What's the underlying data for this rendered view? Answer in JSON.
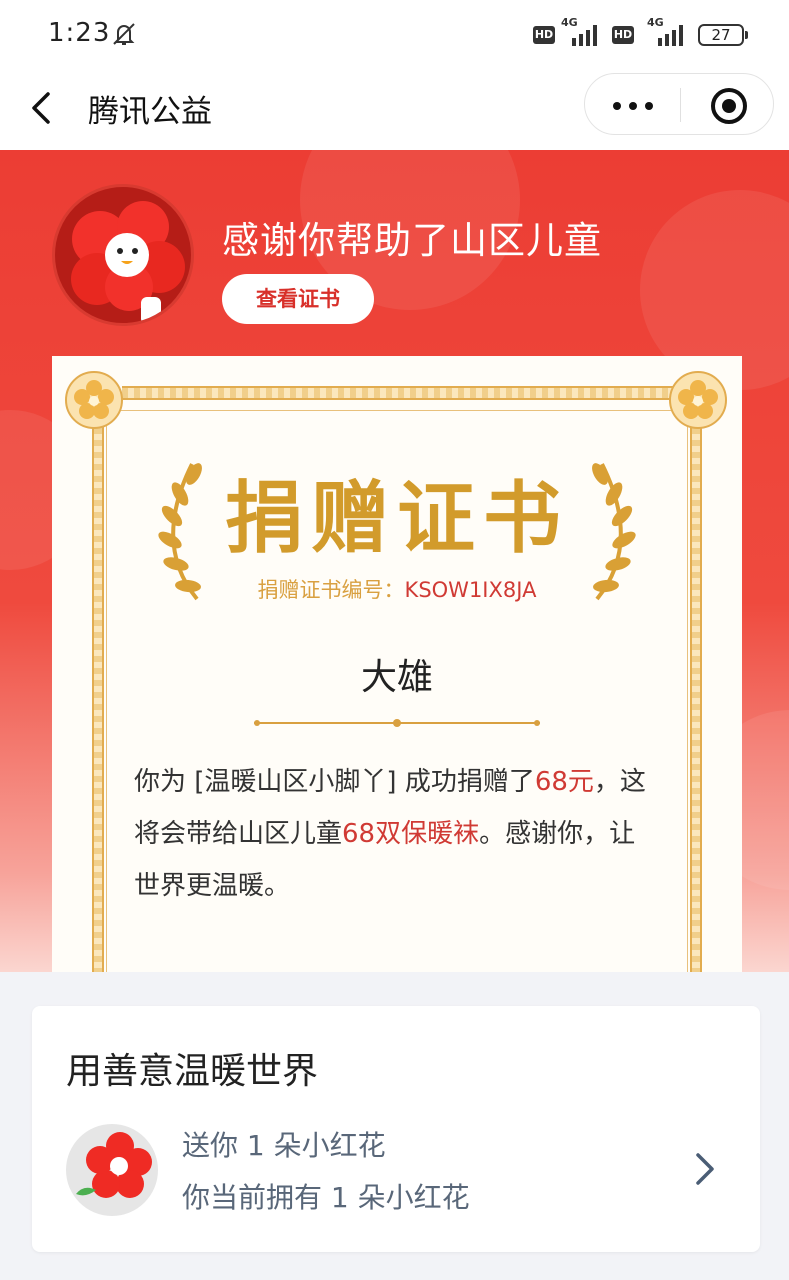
{
  "status_bar": {
    "time": "1:23",
    "network_1": "4G",
    "network_2": "4G",
    "hd_1": "HD",
    "hd_2": "HD",
    "battery": "27"
  },
  "nav": {
    "title": "腾讯公益"
  },
  "hero": {
    "title": "感谢你帮助了山区儿童",
    "view_certificate": "查看证书"
  },
  "certificate": {
    "heading": "捐赠证书",
    "number_label": "捐赠证书编号：",
    "number_value": "KSOW1IX8JA",
    "recipient": "大雄",
    "body_1": "你为 [温暖山区小脚丫] 成功捐赠了",
    "amount": "68元",
    "body_2": "，这将会带给山区儿童",
    "gift": "68双保暖袜",
    "body_3": "。感谢你，让世界更温暖。"
  },
  "card": {
    "title": "用善意温暖世界",
    "line1": "送你 1 朵小红花",
    "line2": "你当前拥有 1 朵小红花"
  },
  "colors": {
    "brand_red": "#ec3d34",
    "gold": "#d29b2b",
    "highlight_red": "#d03a34"
  }
}
